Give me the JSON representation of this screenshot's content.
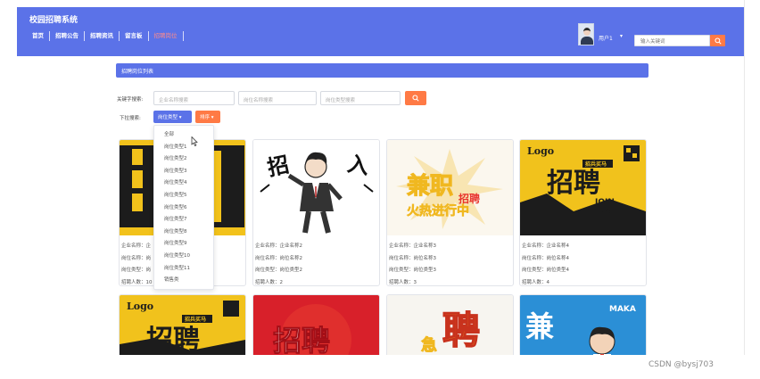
{
  "header": {
    "app_title": "校园招聘系统",
    "nav": [
      "首页",
      "招聘公告",
      "招聘资讯",
      "留言板",
      "招聘岗位"
    ],
    "user_name": "用户1",
    "user_caret": "▾",
    "search_placeholder": "输入关键词",
    "accent": "#5b72e8",
    "button_color": "#ff7a45"
  },
  "main": {
    "section_title": "招聘岗位列表",
    "keyword_label": "关键字搜索:",
    "keyword_inputs": [
      "企业名称搜索",
      "岗位名称搜索",
      "岗位类型搜索"
    ],
    "dropdown_label": "下拉搜索:",
    "type_button": "岗位类型",
    "sort_button": "排序"
  },
  "dropdown_menu": [
    "全部",
    "岗位类型1",
    "岗位类型2",
    "岗位类型3",
    "岗位类型4",
    "岗位类型5",
    "岗位类型6",
    "岗位类型7",
    "岗位类型8",
    "岗位类型9",
    "岗位类型10",
    "岗位类型11",
    "销售类"
  ],
  "cards": [
    {
      "company": "企业名称：企",
      "position": "岗位名称：岗",
      "type": "岗位类型：岗",
      "count": "招聘人数：10"
    },
    {
      "company": "企业名称：企业名称2",
      "position": "岗位名称：岗位名称2",
      "type": "岗位类型：岗位类型2",
      "count": "招聘人数：2"
    },
    {
      "company": "企业名称：企业名称3",
      "position": "岗位名称：岗位名称3",
      "type": "岗位类型：岗位类型3",
      "count": "招聘人数：3"
    },
    {
      "company": "企业名称：企业名称4",
      "position": "岗位名称：岗位名称4",
      "type": "岗位类型：岗位类型4",
      "count": "招聘人数：4"
    }
  ],
  "card_images": {
    "c1_text": "聘",
    "c2_text_a": "招",
    "c2_text_b": "入",
    "c3_text_a": "兼职",
    "c3_text_b": "招聘",
    "c3_text_c": "火热进行中",
    "c4_logo": "Logo",
    "c4_text": "招聘",
    "c4_badge": "招兵买马",
    "c4_join": "JOIN",
    "c4_us": "US",
    "r2c1_logo": "Logo",
    "r2c1_text": "招聘",
    "r2c1_badge": "招兵买马",
    "r2c2_text": "招聘",
    "r2c3_text_a": "急",
    "r2c3_text_b": "聘",
    "r2c4_text": "兼",
    "r2c4_brand": "MAKA"
  },
  "watermark": "CSDN @bysj703"
}
